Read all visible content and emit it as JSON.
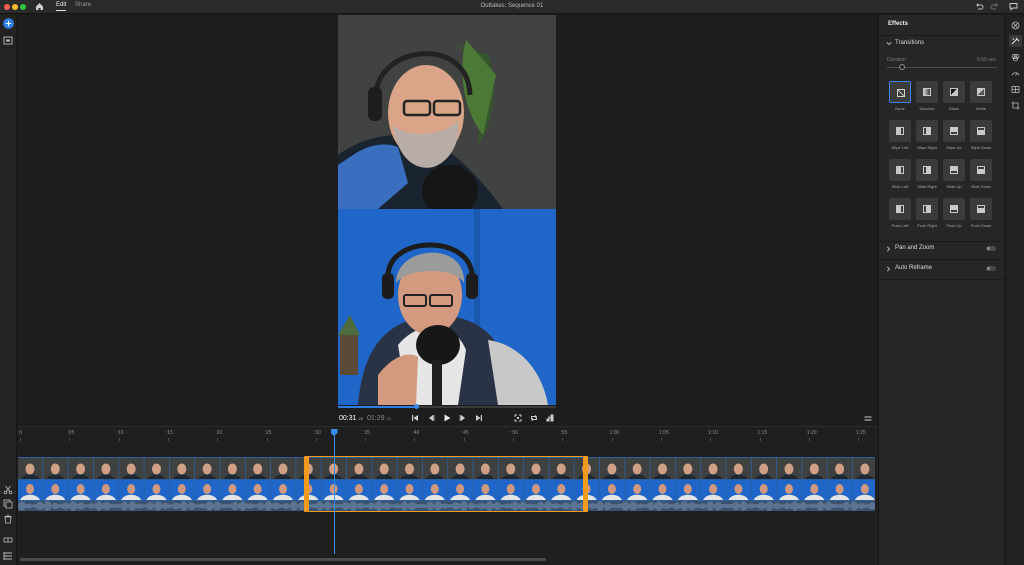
{
  "window": {
    "title": "Outtakes: Sequence 01",
    "menu": {
      "edit": "Edit",
      "share": "Share"
    },
    "traffic_lights": [
      "#ff5f57",
      "#febc2e",
      "#28c840"
    ]
  },
  "player": {
    "current_time": "00:31",
    "current_frames": "20",
    "total_time": "01:29",
    "total_frames": "22",
    "progress": 0.36
  },
  "timeline": {
    "ruler": [
      ":0",
      ":05",
      ":10",
      ":15",
      ":20",
      ":25",
      ":30",
      ":35",
      ":40",
      ":45",
      ":50",
      ":55",
      "1:00",
      "1:05",
      "1:10",
      "1:15",
      "1:20",
      "1:25"
    ],
    "playhead_seconds": 31.8,
    "total_seconds": 89.0,
    "selection_start_seconds": 29.1,
    "selection_end_seconds": 57.3,
    "accent": "#f29a1b",
    "playhead_color": "#3a8ef2"
  },
  "effects": {
    "title": "Effects",
    "transitions": {
      "label": "Transitions",
      "duration_label": "Duration",
      "duration_value": "0.50 sec",
      "items": [
        {
          "label": "None",
          "icon": "no-transition-icon",
          "selected": true
        },
        {
          "label": "Dissolve",
          "icon": "dissolve-icon"
        },
        {
          "label": "Black",
          "icon": "fade-black-icon"
        },
        {
          "label": "White",
          "icon": "fade-white-icon"
        },
        {
          "label": "Wipe Left",
          "icon": "wipe-left-icon"
        },
        {
          "label": "Wipe Right",
          "icon": "wipe-right-icon"
        },
        {
          "label": "Wipe Up",
          "icon": "wipe-up-icon"
        },
        {
          "label": "Wipe Down",
          "icon": "wipe-down-icon"
        },
        {
          "label": "Slide Left",
          "icon": "slide-left-icon"
        },
        {
          "label": "Slide Right",
          "icon": "slide-right-icon"
        },
        {
          "label": "Slide Up",
          "icon": "slide-up-icon"
        },
        {
          "label": "Slide Down",
          "icon": "slide-down-icon"
        },
        {
          "label": "Push Left",
          "icon": "push-left-icon"
        },
        {
          "label": "Push Right",
          "icon": "push-right-icon"
        },
        {
          "label": "Push Up",
          "icon": "push-up-icon"
        },
        {
          "label": "Push Down",
          "icon": "push-down-icon"
        }
      ]
    },
    "pan_zoom": {
      "label": "Pan and Zoom"
    },
    "auto_reframe": {
      "label": "Auto Reframe"
    }
  }
}
